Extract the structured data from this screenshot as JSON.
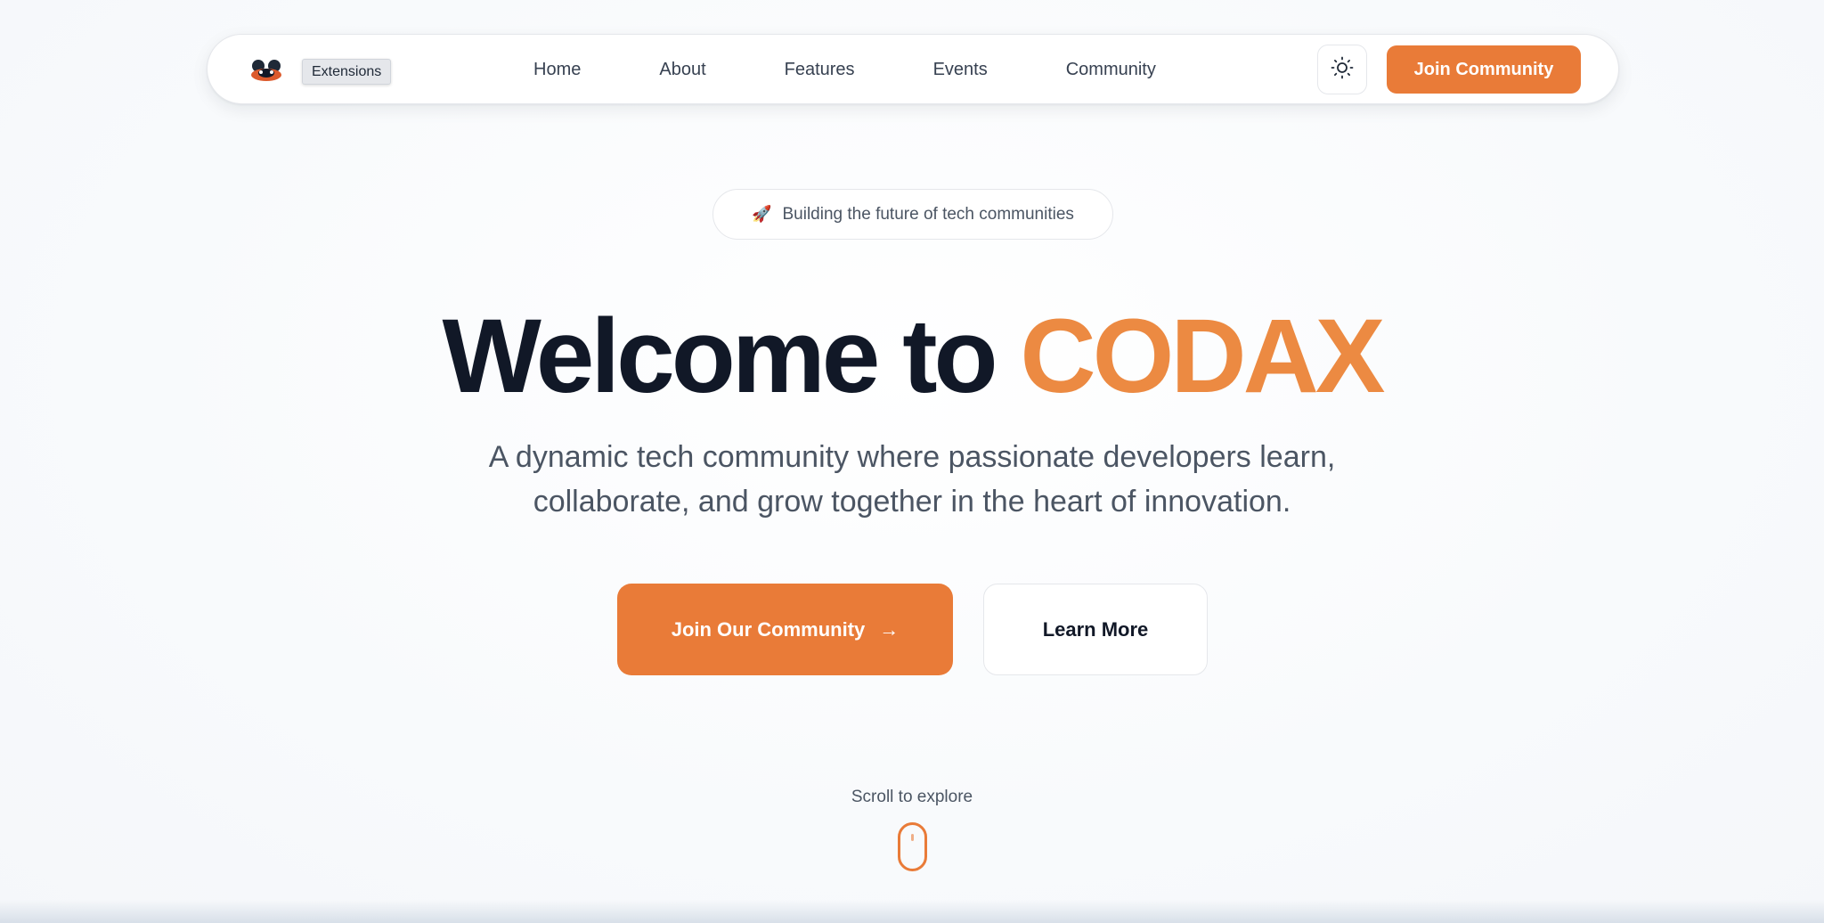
{
  "navbar": {
    "logo_icon": "codax-mascot-icon",
    "extensions_tooltip": "Extensions",
    "links": [
      "Home",
      "About",
      "Features",
      "Events",
      "Community"
    ],
    "theme_toggle_icon": "sun-icon",
    "join_label": "Join Community"
  },
  "hero": {
    "badge_icon": "🚀",
    "badge_text": "Building the future of tech communities",
    "title_prefix": "Welcome to",
    "title_brand": "CODAX",
    "subtitle": "A dynamic tech community where passionate developers learn, collaborate, and grow together in the heart of innovation.",
    "primary_cta": "Join Our Community",
    "primary_cta_icon": "→",
    "secondary_cta": "Learn More",
    "scroll_hint": "Scroll to explore"
  },
  "colors": {
    "accent": "#e97b38",
    "brand_text": "#ec8a42",
    "heading": "#111827",
    "body_text": "#4b5563"
  }
}
